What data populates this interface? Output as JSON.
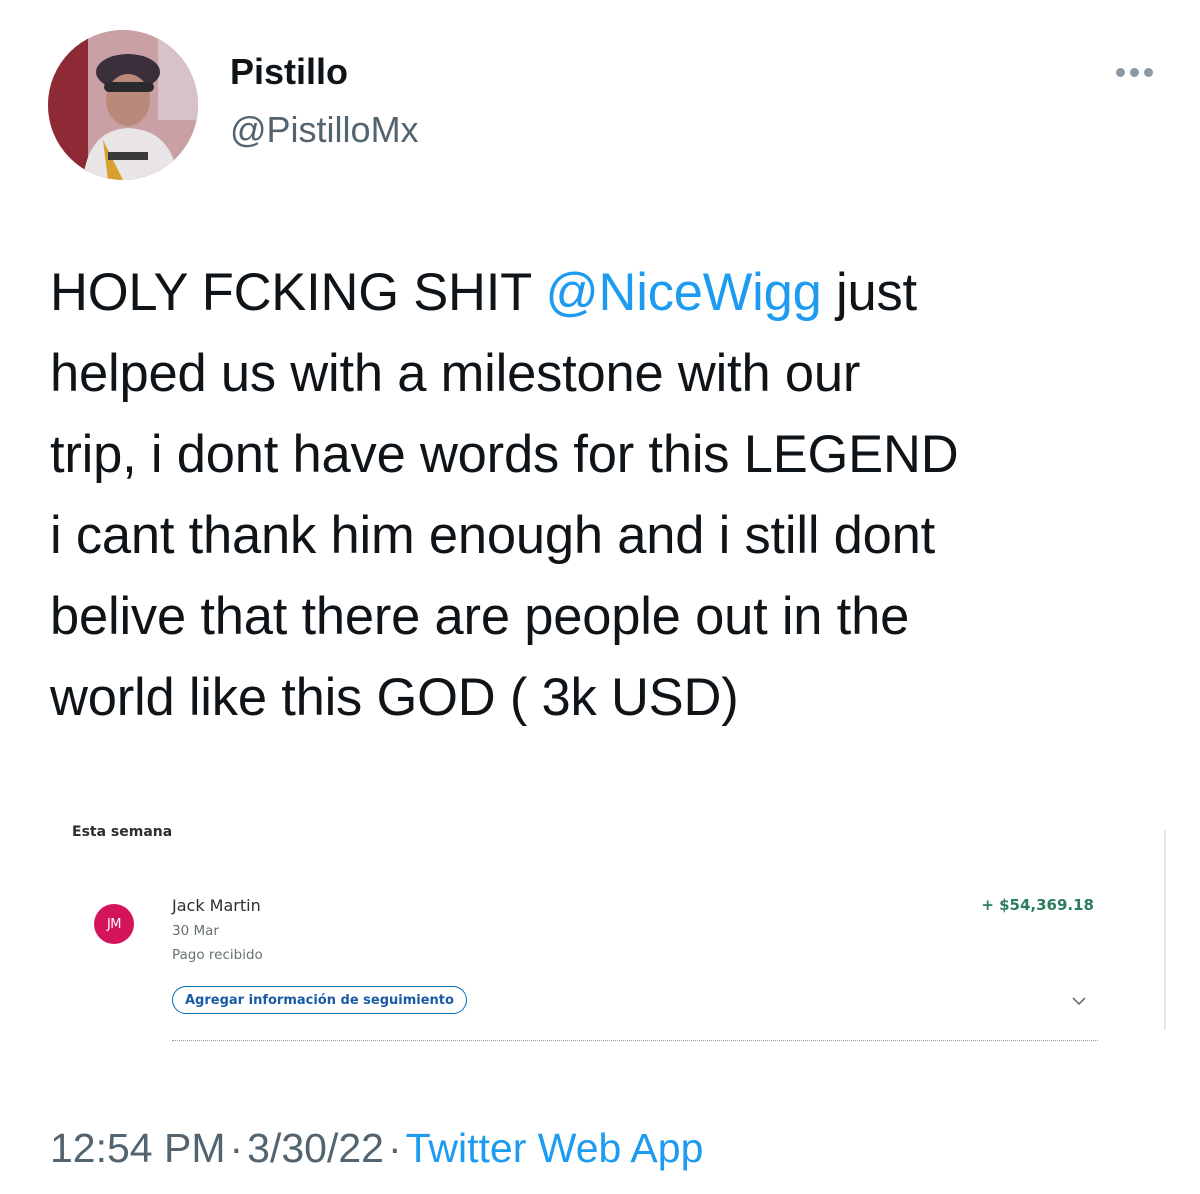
{
  "author": {
    "display_name": "Pistillo",
    "handle": "@PistilloMx"
  },
  "tweet": {
    "text_part1": "HOLY FCKING SHIT ",
    "mention": "@NiceWigg",
    "text_part2": " just\nhelped us with a milestone with our\ntrip, i dont have words for this LEGEND\ni cant thank him enough and i still dont\nbelive that there are people out in the\nworld like this GOD ( 3k USD)"
  },
  "attached_screenshot": {
    "section_label": "Esta semana",
    "transaction": {
      "initials": "JM",
      "name": "Jack Martin",
      "date": "30 Mar",
      "status": "Pago recibido",
      "amount": "+ $54,369.18",
      "tracking_button": "Agregar información de seguimiento"
    },
    "colors": {
      "avatar_bg": "#d4145a",
      "amount": "#2b7d5b",
      "button_border": "#0070ba"
    }
  },
  "meta": {
    "time": "12:54 PM",
    "separator": "·",
    "date": "3/30/22",
    "source": "Twitter Web App"
  },
  "icons": {
    "more": "more-horizontal-icon",
    "expand": "chevron-down-icon"
  },
  "colors": {
    "accent": "#1d9bf0",
    "secondary_text": "#536471",
    "primary_text": "#0f1419"
  }
}
